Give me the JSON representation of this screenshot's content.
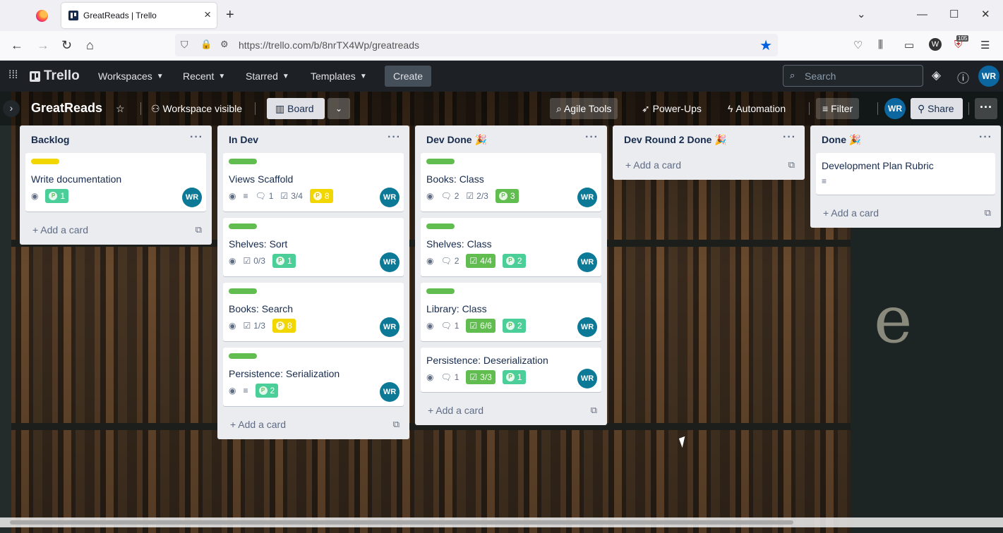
{
  "browser": {
    "tab_title": "GreatReads | Trello",
    "url": "https://trello.com/b/8nrTX4Wp/greatreads",
    "ext_badge": "105"
  },
  "header": {
    "logo": "Trello",
    "menus": [
      "Workspaces",
      "Recent",
      "Starred",
      "Templates"
    ],
    "create_label": "Create",
    "search_placeholder": "Search",
    "avatar": "WR"
  },
  "board": {
    "title": "GreatReads",
    "visibility": "Workspace visible",
    "view": "Board",
    "agile_tools": "Agile Tools",
    "power_ups": "Power-Ups",
    "automation": "Automation",
    "filter": "Filter",
    "share": "Share",
    "member": "WR"
  },
  "lists": [
    {
      "title": "Backlog",
      "add_card": "Add a card",
      "cards": [
        {
          "title": "Write documentation",
          "label": "#f2d600",
          "watch": true,
          "points": "1",
          "avatar": "WR"
        }
      ]
    },
    {
      "title": "In Dev",
      "add_card": "Add a card",
      "cards": [
        {
          "title": "Views Scaffold",
          "label": "#61bd4f",
          "watch": true,
          "description": true,
          "comments": "1",
          "checklist": "3/4",
          "points": "8",
          "points_color": "yellow",
          "avatar": "WR"
        },
        {
          "title": "Shelves: Sort",
          "label": "#61bd4f",
          "watch": true,
          "checklist": "0/3",
          "points": "1",
          "avatar": "WR"
        },
        {
          "title": "Books: Search",
          "label": "#61bd4f",
          "watch": true,
          "checklist": "1/3",
          "points": "8",
          "points_color": "yellow",
          "avatar": "WR"
        },
        {
          "title": "Persistence: Serialization",
          "label": "#61bd4f",
          "watch": true,
          "description": true,
          "points": "2",
          "avatar": "WR"
        }
      ]
    },
    {
      "title": "Dev Done 🎉",
      "add_card": "Add a card",
      "cards": [
        {
          "title": "Books: Class",
          "label": "#61bd4f",
          "watch": true,
          "comments": "2",
          "checklist": "2/3",
          "points": "3",
          "points_color": "green",
          "avatar": "WR"
        },
        {
          "title": "Shelves: Class",
          "label": "#61bd4f",
          "watch": true,
          "comments": "2",
          "checklist_done": "4/4",
          "points": "2",
          "avatar": "WR"
        },
        {
          "title": "Library: Class",
          "label": "#61bd4f",
          "watch": true,
          "comments": "1",
          "checklist_done": "6/6",
          "points": "2",
          "avatar": "WR"
        },
        {
          "title": "Persistence: Deserialization",
          "watch": true,
          "comments": "1",
          "checklist_done": "3/3",
          "points": "1",
          "avatar": "WR"
        }
      ]
    },
    {
      "title": "Dev Round 2 Done 🎉",
      "add_card": "Add a card",
      "cards": []
    },
    {
      "title": "Done 🎉",
      "add_card": "Add a card",
      "cards": [
        {
          "title": "Development Plan Rubric",
          "description": true
        }
      ]
    }
  ]
}
